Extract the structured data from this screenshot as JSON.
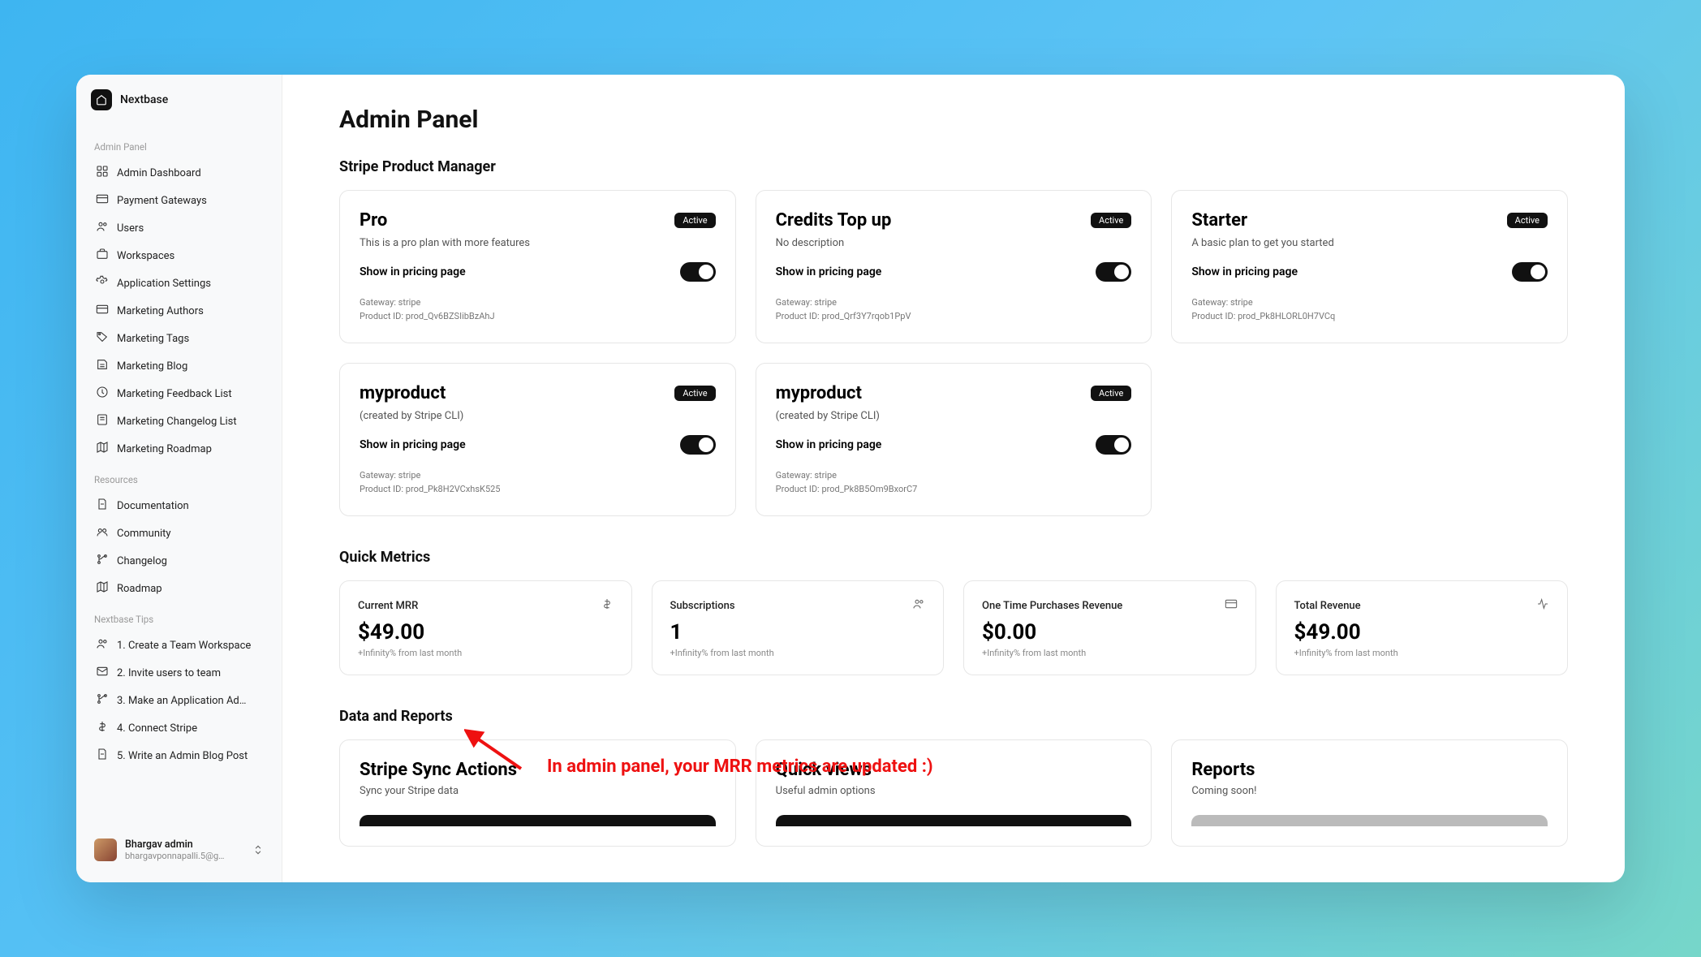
{
  "brand": "Nextbase",
  "sidebar": {
    "sections": [
      {
        "label": "Admin Panel",
        "items": [
          {
            "icon": "dashboard",
            "label": "Admin Dashboard"
          },
          {
            "icon": "card",
            "label": "Payment Gateways"
          },
          {
            "icon": "users",
            "label": "Users"
          },
          {
            "icon": "workspace",
            "label": "Workspaces"
          },
          {
            "icon": "settings",
            "label": "Application Settings"
          },
          {
            "icon": "card",
            "label": "Marketing Authors"
          },
          {
            "icon": "tag",
            "label": "Marketing Tags"
          },
          {
            "icon": "blog",
            "label": "Marketing Blog"
          },
          {
            "icon": "feedback",
            "label": "Marketing Feedback List"
          },
          {
            "icon": "changelog",
            "label": "Marketing Changelog List"
          },
          {
            "icon": "roadmap",
            "label": "Marketing Roadmap"
          }
        ]
      },
      {
        "label": "Resources",
        "items": [
          {
            "icon": "doc",
            "label": "Documentation"
          },
          {
            "icon": "community",
            "label": "Community"
          },
          {
            "icon": "branch",
            "label": "Changelog"
          },
          {
            "icon": "roadmap",
            "label": "Roadmap"
          }
        ]
      },
      {
        "label": "Nextbase Tips",
        "items": [
          {
            "icon": "users",
            "label": "1. Create a Team Workspace"
          },
          {
            "icon": "mail",
            "label": "2. Invite users to team"
          },
          {
            "icon": "branch",
            "label": "3. Make an Application Ad…"
          },
          {
            "icon": "dollar",
            "label": "4. Connect Stripe"
          },
          {
            "icon": "doc",
            "label": "5. Write an Admin Blog Post"
          }
        ]
      }
    ]
  },
  "user": {
    "name": "Bhargav admin",
    "email": "bhargavponnapalli.5@g…"
  },
  "pageTitle": "Admin Panel",
  "stripeSection": {
    "title": "Stripe Product Manager",
    "toggleLabel": "Show in pricing page",
    "gatewayPrefix": "Gateway: ",
    "productIdPrefix": "Product ID: ",
    "products": [
      {
        "name": "Pro",
        "status": "Active",
        "desc": "This is a pro plan with more features",
        "gateway": "stripe",
        "productId": "prod_Qv6BZSIibBzAhJ"
      },
      {
        "name": "Credits Top up",
        "status": "Active",
        "desc": "No description",
        "gateway": "stripe",
        "productId": "prod_Qrf3Y7rqob1PpV"
      },
      {
        "name": "Starter",
        "status": "Active",
        "desc": "A basic plan to get you started",
        "gateway": "stripe",
        "productId": "prod_Pk8HLORL0H7VCq"
      },
      {
        "name": "myproduct",
        "status": "Active",
        "desc": "(created by Stripe CLI)",
        "gateway": "stripe",
        "productId": "prod_Pk8H2VCxhsK525"
      },
      {
        "name": "myproduct",
        "status": "Active",
        "desc": "(created by Stripe CLI)",
        "gateway": "stripe",
        "productId": "prod_Pk8B5Om9BxorC7"
      }
    ]
  },
  "metricsSection": {
    "title": "Quick Metrics",
    "metrics": [
      {
        "label": "Current MRR",
        "value": "$49.00",
        "sub": "+Infinity% from last month",
        "icon": "dollar"
      },
      {
        "label": "Subscriptions",
        "value": "1",
        "sub": "+Infinity% from last month",
        "icon": "users"
      },
      {
        "label": "One Time Purchases Revenue",
        "value": "$0.00",
        "sub": "+Infinity% from last month",
        "icon": "card"
      },
      {
        "label": "Total Revenue",
        "value": "$49.00",
        "sub": "+Infinity% from last month",
        "icon": "activity"
      }
    ]
  },
  "reportsSection": {
    "title": "Data and Reports",
    "cards": [
      {
        "title": "Stripe Sync Actions",
        "desc": "Sync your Stripe data",
        "btn": "dark"
      },
      {
        "title": "Quick views",
        "desc": "Useful admin options",
        "btn": "dark"
      },
      {
        "title": "Reports",
        "desc": "Coming soon!",
        "btn": "gray"
      }
    ]
  },
  "annotation": "In admin panel, your MRR metrics are updated :)"
}
